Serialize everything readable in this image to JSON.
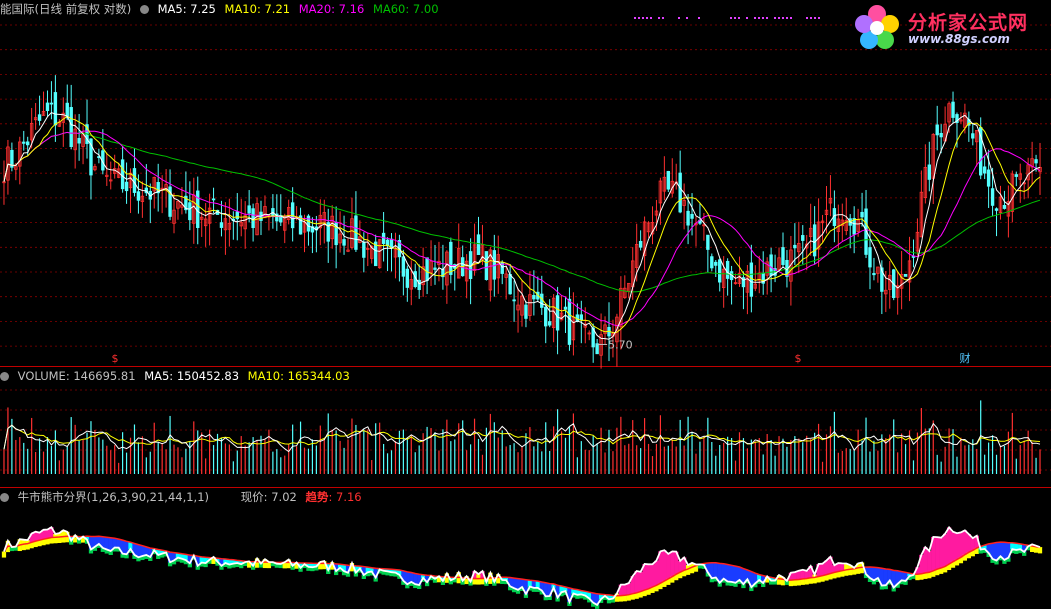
{
  "colors": {
    "background": "#000000",
    "grid": "#8b0000",
    "up": "#ff3030",
    "down": "#54ffff",
    "ma5": "#ffffff",
    "ma10": "#ffff00",
    "ma20": "#ff00ff",
    "ma60": "#00c000",
    "volume_label": "#c0c0c0",
    "bull_label": "#ff3030"
  },
  "price_panel": {
    "title": "能国际(日线 前复权 对数)",
    "ma5": "MA5: 7.25",
    "ma10": "MA10: 7.21",
    "ma20": "MA20: 7.16",
    "ma60": "MA60: 7.00",
    "low_marker": "5.70",
    "marks": [
      "$",
      "$",
      "财"
    ]
  },
  "volume_panel": {
    "volume": "VOLUME: 146695.81",
    "ma5": "MA5: 150452.83",
    "ma10": "MA10: 165344.03"
  },
  "indicator_panel": {
    "name": "牛市熊市分界(1,26,3,90,21,44,1,1)",
    "price_label": "现价: 7.02",
    "trend_label": "趋势",
    "trend_value": ": 7.16"
  },
  "logo": {
    "title": "分析家公式网",
    "url": "www.88gs.com",
    "icon": "flower-icon"
  },
  "chart_data": {
    "type": "candlestick",
    "price_anchor_points": [
      {
        "bar": 0,
        "close": 7.3
      },
      {
        "bar": 12,
        "close": 7.8
      },
      {
        "bar": 28,
        "close": 7.1
      },
      {
        "bar": 55,
        "close": 6.8
      },
      {
        "bar": 80,
        "close": 6.7
      },
      {
        "bar": 105,
        "close": 6.3
      },
      {
        "bar": 120,
        "close": 6.4
      },
      {
        "bar": 135,
        "close": 6.0
      },
      {
        "bar": 150,
        "close": 5.7
      },
      {
        "bar": 168,
        "close": 7.0
      },
      {
        "bar": 185,
        "close": 6.2
      },
      {
        "bar": 200,
        "close": 6.4
      },
      {
        "bar": 212,
        "close": 6.9
      },
      {
        "bar": 225,
        "close": 6.1
      },
      {
        "bar": 240,
        "close": 7.9
      },
      {
        "bar": 252,
        "close": 7.0
      },
      {
        "bar": 262,
        "close": 7.2
      }
    ],
    "last_values": {
      "MA5": 7.25,
      "MA10": 7.21,
      "MA20": 7.16,
      "MA60": 7.0,
      "VOLUME": 146695.81,
      "VOL_MA5": 150452.83,
      "VOL_MA10": 165344.03,
      "现价": 7.02,
      "趋势": 7.16
    },
    "period_low": 5.7,
    "series": [
      "MA5",
      "MA10",
      "MA20",
      "MA60"
    ],
    "log_scale": true,
    "grid": true
  }
}
